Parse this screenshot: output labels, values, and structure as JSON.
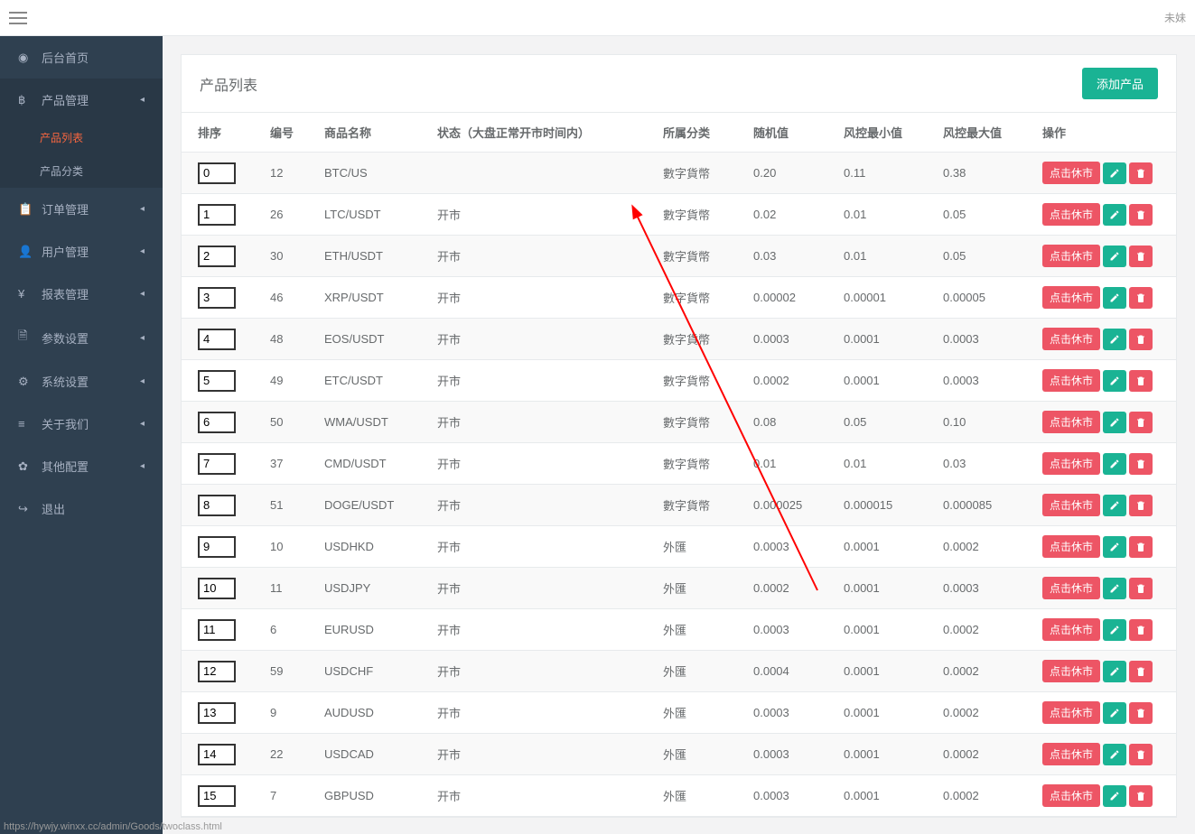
{
  "topbar": {
    "right_text": "未妹"
  },
  "sidebar": {
    "items": [
      {
        "icon": "dashboard",
        "label": "后台首页",
        "has_sub": false
      },
      {
        "icon": "bitcoin",
        "label": "产品管理",
        "has_sub": true,
        "expanded": true,
        "active_parent": true,
        "sub": [
          {
            "label": "产品列表",
            "active": true
          },
          {
            "label": "产品分类",
            "active": false
          }
        ]
      },
      {
        "icon": "clipboard",
        "label": "订单管理",
        "has_sub": true
      },
      {
        "icon": "user",
        "label": "用户管理",
        "has_sub": true
      },
      {
        "icon": "yen",
        "label": "报表管理",
        "has_sub": true
      },
      {
        "icon": "file",
        "label": "参数设置",
        "has_sub": true
      },
      {
        "icon": "gear",
        "label": "系统设置",
        "has_sub": true
      },
      {
        "icon": "bars",
        "label": "关于我们",
        "has_sub": true
      },
      {
        "icon": "cog",
        "label": "其他配置",
        "has_sub": true
      },
      {
        "icon": "logout",
        "label": "退出",
        "has_sub": false
      }
    ]
  },
  "panel": {
    "title": "产品列表",
    "add_btn": "添加产品"
  },
  "table": {
    "headers": [
      "排序",
      "编号",
      "商品名称",
      "状态（大盘正常开市时间内）",
      "所属分类",
      "随机值",
      "风控最小值",
      "风控最大值",
      "操作"
    ],
    "action_label": "点击休市",
    "rows": [
      {
        "sort": "0",
        "id": "12",
        "name": "BTC/US",
        "status": "",
        "cat": "數字貨幣",
        "rand": "0.20",
        "min": "0.11",
        "max": "0.38"
      },
      {
        "sort": "1",
        "id": "26",
        "name": "LTC/USDT",
        "status": "开市",
        "cat": "數字貨幣",
        "rand": "0.02",
        "min": "0.01",
        "max": "0.05"
      },
      {
        "sort": "2",
        "id": "30",
        "name": "ETH/USDT",
        "status": "开市",
        "cat": "數字貨幣",
        "rand": "0.03",
        "min": "0.01",
        "max": "0.05"
      },
      {
        "sort": "3",
        "id": "46",
        "name": "XRP/USDT",
        "status": "开市",
        "cat": "數字貨幣",
        "rand": "0.00002",
        "min": "0.00001",
        "max": "0.00005"
      },
      {
        "sort": "4",
        "id": "48",
        "name": "EOS/USDT",
        "status": "开市",
        "cat": "數字貨幣",
        "rand": "0.0003",
        "min": "0.0001",
        "max": "0.0003"
      },
      {
        "sort": "5",
        "id": "49",
        "name": "ETC/USDT",
        "status": "开市",
        "cat": "數字貨幣",
        "rand": "0.0002",
        "min": "0.0001",
        "max": "0.0003"
      },
      {
        "sort": "6",
        "id": "50",
        "name": "WMA/USDT",
        "status": "开市",
        "cat": "數字貨幣",
        "rand": "0.08",
        "min": "0.05",
        "max": "0.10"
      },
      {
        "sort": "7",
        "id": "37",
        "name": "CMD/USDT",
        "status": "开市",
        "cat": "數字貨幣",
        "rand": "0.01",
        "min": "0.01",
        "max": "0.03"
      },
      {
        "sort": "8",
        "id": "51",
        "name": "DOGE/USDT",
        "status": "开市",
        "cat": "數字貨幣",
        "rand": "0.000025",
        "min": "0.000015",
        "max": "0.000085"
      },
      {
        "sort": "9",
        "id": "10",
        "name": "USDHKD",
        "status": "开市",
        "cat": "外匯",
        "rand": "0.0003",
        "min": "0.0001",
        "max": "0.0002"
      },
      {
        "sort": "10",
        "id": "11",
        "name": "USDJPY",
        "status": "开市",
        "cat": "外匯",
        "rand": "0.0002",
        "min": "0.0001",
        "max": "0.0003"
      },
      {
        "sort": "11",
        "id": "6",
        "name": "EURUSD",
        "status": "开市",
        "cat": "外匯",
        "rand": "0.0003",
        "min": "0.0001",
        "max": "0.0002"
      },
      {
        "sort": "12",
        "id": "59",
        "name": "USDCHF",
        "status": "开市",
        "cat": "外匯",
        "rand": "0.0004",
        "min": "0.0001",
        "max": "0.0002"
      },
      {
        "sort": "13",
        "id": "9",
        "name": "AUDUSD",
        "status": "开市",
        "cat": "外匯",
        "rand": "0.0003",
        "min": "0.0001",
        "max": "0.0002"
      },
      {
        "sort": "14",
        "id": "22",
        "name": "USDCAD",
        "status": "开市",
        "cat": "外匯",
        "rand": "0.0003",
        "min": "0.0001",
        "max": "0.0002"
      },
      {
        "sort": "15",
        "id": "7",
        "name": "GBPUSD",
        "status": "开市",
        "cat": "外匯",
        "rand": "0.0003",
        "min": "0.0001",
        "max": "0.0002"
      }
    ]
  },
  "status_link": "https://hywjy.winxx.cc/admin/Goods/twoclass.html"
}
